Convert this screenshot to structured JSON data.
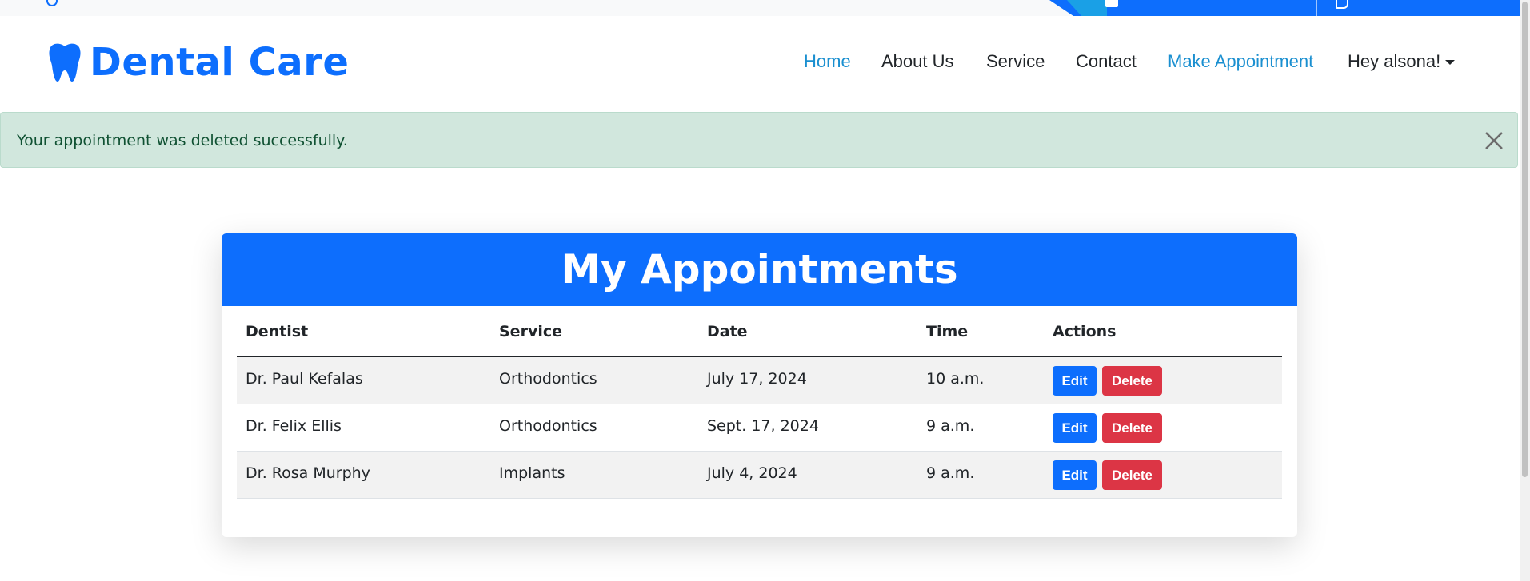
{
  "brand": {
    "name": "Dental Care"
  },
  "nav": {
    "items": [
      {
        "label": "Home"
      },
      {
        "label": "About Us"
      },
      {
        "label": "Service"
      },
      {
        "label": "Contact"
      },
      {
        "label": "Make Appointment"
      },
      {
        "label": "Hey alsona!"
      }
    ]
  },
  "alert": {
    "message": "Your appointment was deleted successfully."
  },
  "appointments": {
    "title": "My Appointments",
    "columns": [
      "Dentist",
      "Service",
      "Date",
      "Time",
      "Actions"
    ],
    "rows": [
      {
        "dentist": "Dr. Paul Kefalas",
        "service": "Orthodontics",
        "date": "July 17, 2024",
        "time": "10 a.m."
      },
      {
        "dentist": "Dr. Felix Ellis",
        "service": "Orthodontics",
        "date": "Sept. 17, 2024",
        "time": "9 a.m."
      },
      {
        "dentist": "Dr. Rosa Murphy",
        "service": "Implants",
        "date": "July 4, 2024",
        "time": "9 a.m."
      }
    ],
    "edit_label": "Edit",
    "delete_label": "Delete"
  },
  "colors": {
    "primary": "#0d6efd",
    "danger": "#dc3545",
    "alert_bg": "#d1e7dd",
    "alert_text": "#0f5132"
  }
}
